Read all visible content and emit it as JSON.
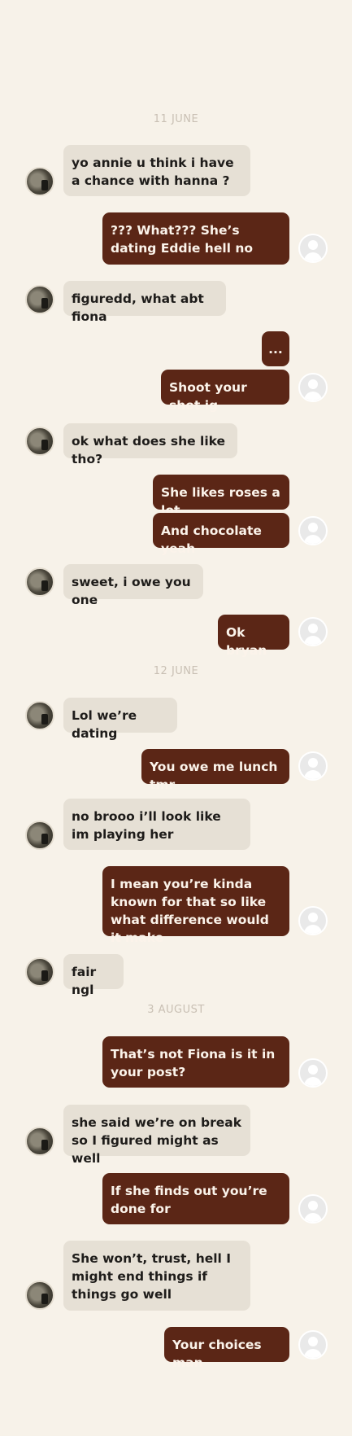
{
  "dates": [
    "11 JUNE",
    "12 JUNE",
    "3 AUGUST"
  ],
  "messages": [
    {
      "from": "them",
      "text": "yo annie u think i have a chance with hanna ?"
    },
    {
      "from": "me",
      "text": "??? What??? She’s dating Eddie hell no"
    },
    {
      "from": "them",
      "text": "figuredd, what abt fiona"
    },
    {
      "from": "me",
      "text": "..."
    },
    {
      "from": "me",
      "text": "Shoot your shot ig"
    },
    {
      "from": "them",
      "text": "ok what does she like tho?"
    },
    {
      "from": "me",
      "text": "She likes roses a lot"
    },
    {
      "from": "me",
      "text": "And chocolate yeah"
    },
    {
      "from": "them",
      "text": "sweet, i owe you one"
    },
    {
      "from": "me",
      "text": "Ok bryan"
    },
    {
      "from": "them",
      "text": "Lol we’re dating"
    },
    {
      "from": "me",
      "text": "You owe me lunch tmr"
    },
    {
      "from": "them",
      "text": "no brooo i’ll look like im playing her"
    },
    {
      "from": "me",
      "text": "I mean you’re kinda known for that so like what difference would it make"
    },
    {
      "from": "them",
      "text": "fair ngl"
    },
    {
      "from": "me",
      "text": "That’s not Fiona is it in your post?"
    },
    {
      "from": "them",
      "text": "she said we’re on break so I figured might as well"
    },
    {
      "from": "me",
      "text": "If she finds out you’re done for"
    },
    {
      "from": "them",
      "text": "She won’t, trust, hell I might end things if things go well"
    },
    {
      "from": "me",
      "text": "Your choices man"
    }
  ],
  "avatars": {
    "them": "contact-photo-avatar",
    "me": "default-user-avatar"
  },
  "colors": {
    "background": "#f7f2e9",
    "incoming": "#e6e0d5",
    "outgoing": "#5b2616",
    "date": "#c9c0b4"
  }
}
